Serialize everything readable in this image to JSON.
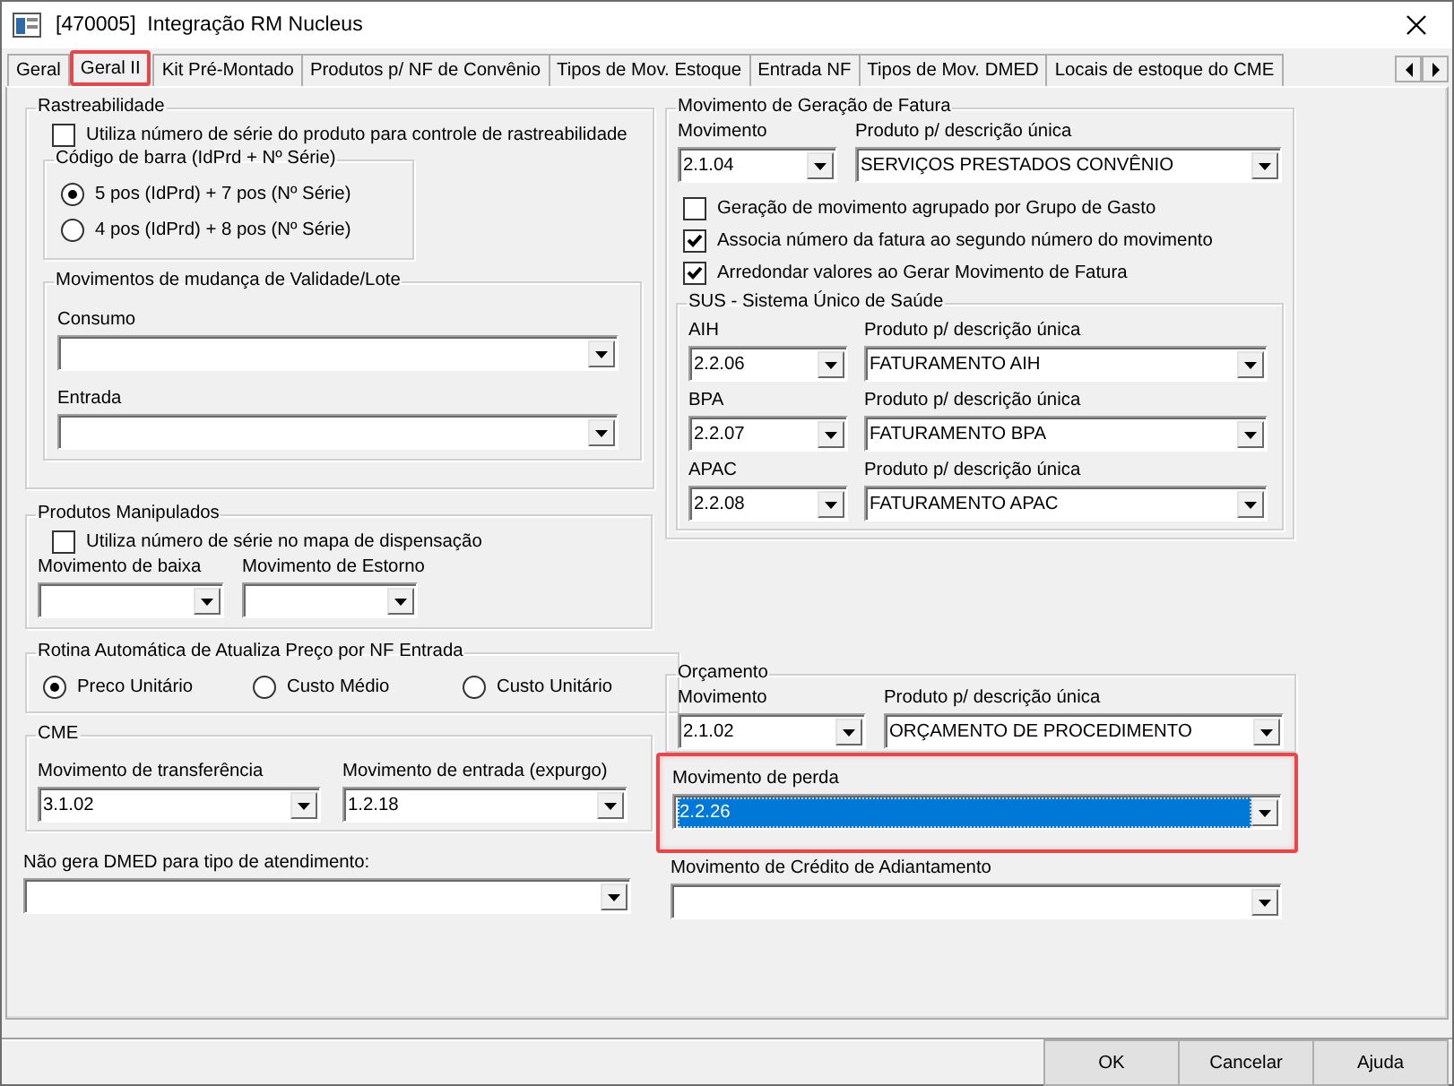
{
  "window": {
    "title": "[470005]  Integração RM Nucleus"
  },
  "tabs": [
    {
      "label": "Geral",
      "selected": false,
      "highlighted": false
    },
    {
      "label": "Geral II",
      "selected": true,
      "highlighted": true
    },
    {
      "label": "Kit Pré-Montado",
      "selected": false,
      "highlighted": false
    },
    {
      "label": "Produtos p/ NF de Convênio",
      "selected": false,
      "highlighted": false
    },
    {
      "label": "Tipos de Mov. Estoque",
      "selected": false,
      "highlighted": false
    },
    {
      "label": "Entrada NF",
      "selected": false,
      "highlighted": false
    },
    {
      "label": "Tipos de Mov. DMED",
      "selected": false,
      "highlighted": false
    },
    {
      "label": "Locais de estoque do CME",
      "selected": false,
      "highlighted": false
    }
  ],
  "rastreabilidade": {
    "title": "Rastreabilidade",
    "checkbox": {
      "label": "Utiliza número de série do produto para controle de rastreabilidade",
      "checked": false
    },
    "codigo_barra": {
      "title": "Código de barra (IdPrd + Nº Série)",
      "options": [
        {
          "label": "5 pos (IdPrd) + 7 pos (Nº Série)",
          "selected": true
        },
        {
          "label": "4 pos (IdPrd) + 8 pos (Nº Série)",
          "selected": false
        }
      ]
    },
    "movimentos_validade": {
      "title": "Movimentos de mudança de Validade/Lote",
      "fields": [
        {
          "label": "Consumo"
        },
        {
          "label": "Entrada"
        }
      ]
    }
  },
  "produtos_manipulados": {
    "title": "Produtos Manipulados",
    "checkbox": {
      "label": "Utiliza número de série no mapa de dispensação",
      "checked": false
    },
    "fields": [
      {
        "label": "Movimento de baixa"
      },
      {
        "label": "Movimento de Estorno"
      }
    ]
  },
  "rotina_preco": {
    "title": "Rotina Automática de Atualiza Preço por NF Entrada",
    "options": [
      {
        "label": "Preco Unitário",
        "selected": true
      },
      {
        "label": "Custo Médio",
        "selected": false
      },
      {
        "label": "Custo Unitário",
        "selected": false
      }
    ]
  },
  "cme": {
    "title": "CME",
    "fields": [
      {
        "label": "Movimento de transferência",
        "value": "3.1.02"
      },
      {
        "label": "Movimento de entrada (expurgo)",
        "value": "1.2.18"
      }
    ]
  },
  "dmed": {
    "label": "Não gera DMED para tipo de atendimento:"
  },
  "fatura": {
    "title": "Movimento de Geração de Fatura",
    "fields": [
      {
        "label": "Movimento",
        "value": "2.1.04"
      },
      {
        "label": "Produto p/ descrição única",
        "value": "SERVIÇOS PRESTADOS CONVÊNIO"
      }
    ],
    "checkboxes": [
      {
        "label": "Geração de movimento agrupado por Grupo de Gasto",
        "checked": false
      },
      {
        "label": "Associa número da fatura ao segundo número do movimento",
        "checked": true
      },
      {
        "label": "Arredondar valores ao Gerar Movimento de Fatura",
        "checked": true
      }
    ],
    "sus": {
      "title": "SUS - Sistema Único de Saúde",
      "rows": [
        {
          "label": "AIH",
          "value": "2.2.06",
          "product_label": "Produto p/ descrição única",
          "product_value": "FATURAMENTO AIH"
        },
        {
          "label": "BPA",
          "value": "2.2.07",
          "product_label": "Produto p/ descrição única",
          "product_value": "FATURAMENTO BPA"
        },
        {
          "label": "APAC",
          "value": "2.2.08",
          "product_label": "Produto p/ descrição única",
          "product_value": "FATURAMENTO APAC"
        }
      ]
    }
  },
  "orcamento": {
    "title": "Orçamento",
    "fields": [
      {
        "label": "Movimento",
        "value": "2.1.02"
      },
      {
        "label": "Produto p/ descrição única",
        "value": "ORÇAMENTO DE PROCEDIMENTO"
      }
    ]
  },
  "perda": {
    "label": "Movimento de perda",
    "value": "2.2.26",
    "selected": true,
    "highlighted": true
  },
  "credito": {
    "label": "Movimento de Crédito de Adiantamento"
  },
  "buttons": [
    {
      "label": "OK"
    },
    {
      "label": "Cancelar"
    },
    {
      "label": "Ajuda"
    }
  ]
}
